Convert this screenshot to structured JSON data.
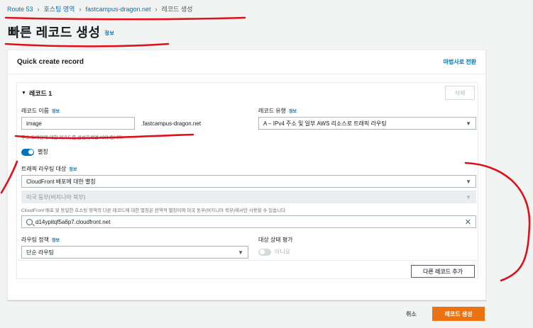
{
  "breadcrumb": {
    "items": [
      "Route 53",
      "호스팅 영역",
      "fastcampus-dragon.net",
      "레코드 생성"
    ]
  },
  "page": {
    "title": "빠른 레코드 생성",
    "info": "정보"
  },
  "panel": {
    "title": "Quick create record",
    "wizard_link": "마법사로 전환"
  },
  "record": {
    "header": "레코드 1",
    "delete_label": "삭제",
    "name_label": "레코드 이름",
    "name_info": "정보",
    "name_value": "image",
    "domain_suffix": ".fastcampus-dragon.net",
    "name_hint": "루트 도메인에 대한 레코드를 생성하려면 비워 둡니다.",
    "type_label": "레코드 유형",
    "type_info": "정보",
    "type_value": "A – IPv4 주소 및 일부 AWS 리소스로 트래픽 라우팅",
    "alias_label": "별칭",
    "alias_on": true,
    "target_label": "트래픽 라우팅 대상",
    "target_info": "정보",
    "endpoint_value": "CloudFront 배포에 대한 별칭",
    "region_value": "미국 동부(버지니아 북부)",
    "cf_hint": "CloudFront 배포 및 동일한 호스팅 영역의 다른 레코드에 대한 별칭은 전역적 별칭이며 미국 동부(버지니아 북부)에서만 사용할 수 있습니다.",
    "distribution_value": "d14ypitqf5a6p7.cloudfront.net",
    "policy_label": "라우팅 정책",
    "policy_info": "정보",
    "policy_value": "단순 라우팅",
    "health_label": "대상 상태 평가",
    "health_value": "아니요",
    "add_another": "다른 레코드 추가"
  },
  "footer": {
    "cancel": "취소",
    "create": "레코드 생성"
  },
  "colors": {
    "link": "#0073bb",
    "primary": "#ec7211",
    "marker": "#e0101a"
  }
}
